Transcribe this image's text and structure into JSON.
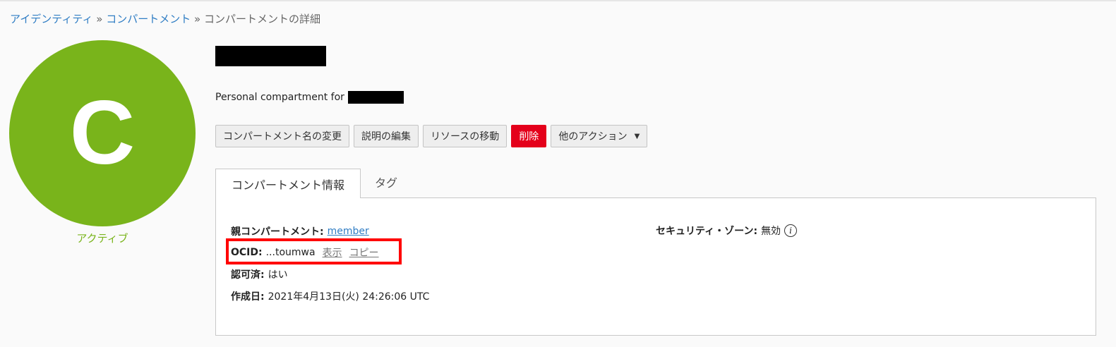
{
  "colors": {
    "avatar_bg": "#79b41b",
    "status_text": "#79b41b",
    "danger_button": "#e4001b",
    "link": "#2f7dc4",
    "highlight": "#ff0000"
  },
  "breadcrumb": {
    "items": [
      "アイデンティティ",
      "コンパートメント"
    ],
    "separator": "»",
    "current": "コンパートメントの詳細"
  },
  "avatar": {
    "letter": "C",
    "status": "アクティブ"
  },
  "header": {
    "title_redacted": true,
    "description_prefix": "Personal compartment for"
  },
  "actions": {
    "rename": "コンパートメント名の変更",
    "edit_description": "説明の編集",
    "move_resource": "リソースの移動",
    "delete": "削除",
    "more_actions": "他のアクション",
    "more_actions_icon": "caret-down-icon"
  },
  "tabs": {
    "info": "コンパートメント情報",
    "tags": "タグ"
  },
  "info": {
    "parent": {
      "label": "親コンパートメント:",
      "value": "member"
    },
    "ocid": {
      "label": "OCID:",
      "value": "...toumwa",
      "show": "表示",
      "copy": "コピー"
    },
    "authorized": {
      "label": "認可済:",
      "value": "はい"
    },
    "created": {
      "label": "作成日:",
      "value": "2021年4月13日(火) 24:26:06 UTC"
    },
    "security_zone": {
      "label": "セキュリティ・ゾーン:",
      "value": "無効",
      "icon": "info-icon"
    }
  }
}
